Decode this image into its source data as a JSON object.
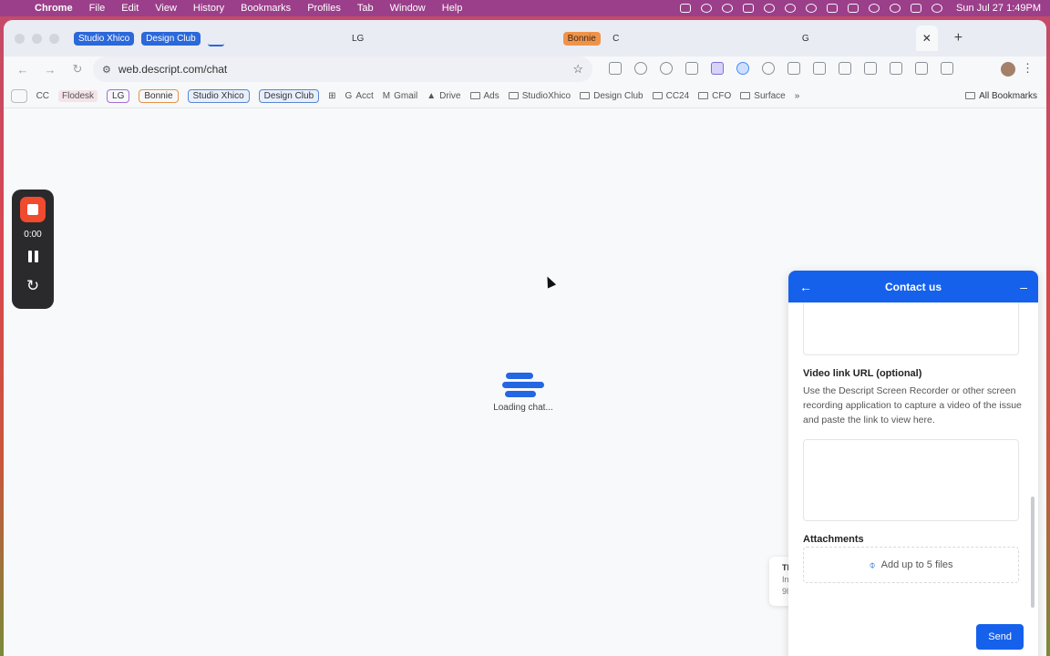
{
  "menubar": {
    "app": "Chrome",
    "items": [
      "File",
      "Edit",
      "View",
      "History",
      "Bookmarks",
      "Profiles",
      "Tab",
      "Window",
      "Help"
    ],
    "datetime": "Sun Jul 27  1:49PM"
  },
  "tabs": {
    "groups": [
      {
        "label": "Studio Xhico",
        "color": "#2b68d9"
      },
      {
        "label": "Design Club",
        "color": "#2b68d9"
      },
      {
        "label": "Bonnie",
        "color": "#f0934a"
      }
    ],
    "favicons": [
      "LG",
      "C",
      "G"
    ],
    "new_tab_label": "+"
  },
  "toolbar": {
    "url": "web.descript.com/chat"
  },
  "bookmarks": {
    "items": [
      {
        "label": "CC"
      },
      {
        "label": "Flodesk"
      },
      {
        "label": "LG"
      },
      {
        "label": "Bonnie"
      },
      {
        "label": "Studio Xhico"
      },
      {
        "label": "Design Club"
      },
      {
        "label": "Acct"
      },
      {
        "label": "Gmail"
      },
      {
        "label": "Drive"
      },
      {
        "label": "Ads"
      },
      {
        "label": "StudioXhico"
      },
      {
        "label": "Design Club"
      },
      {
        "label": "CC24"
      },
      {
        "label": "CFO"
      },
      {
        "label": "Surface"
      }
    ],
    "all_bookmarks": "All Bookmarks"
  },
  "recorder": {
    "time": "0:00"
  },
  "loader": {
    "text": "Loading chat..."
  },
  "toast": {
    "line1": "Th",
    "line2": "In",
    "line3": "9l"
  },
  "contact": {
    "title": "Contact us",
    "video_label": "Video link URL (optional)",
    "video_help": "Use the Descript Screen Recorder or other screen recording application to capture a video of the issue and paste the link to view here.",
    "attachments_label": "Attachments",
    "attachments_hint": "Add up to 5 files",
    "send_label": "Send"
  }
}
